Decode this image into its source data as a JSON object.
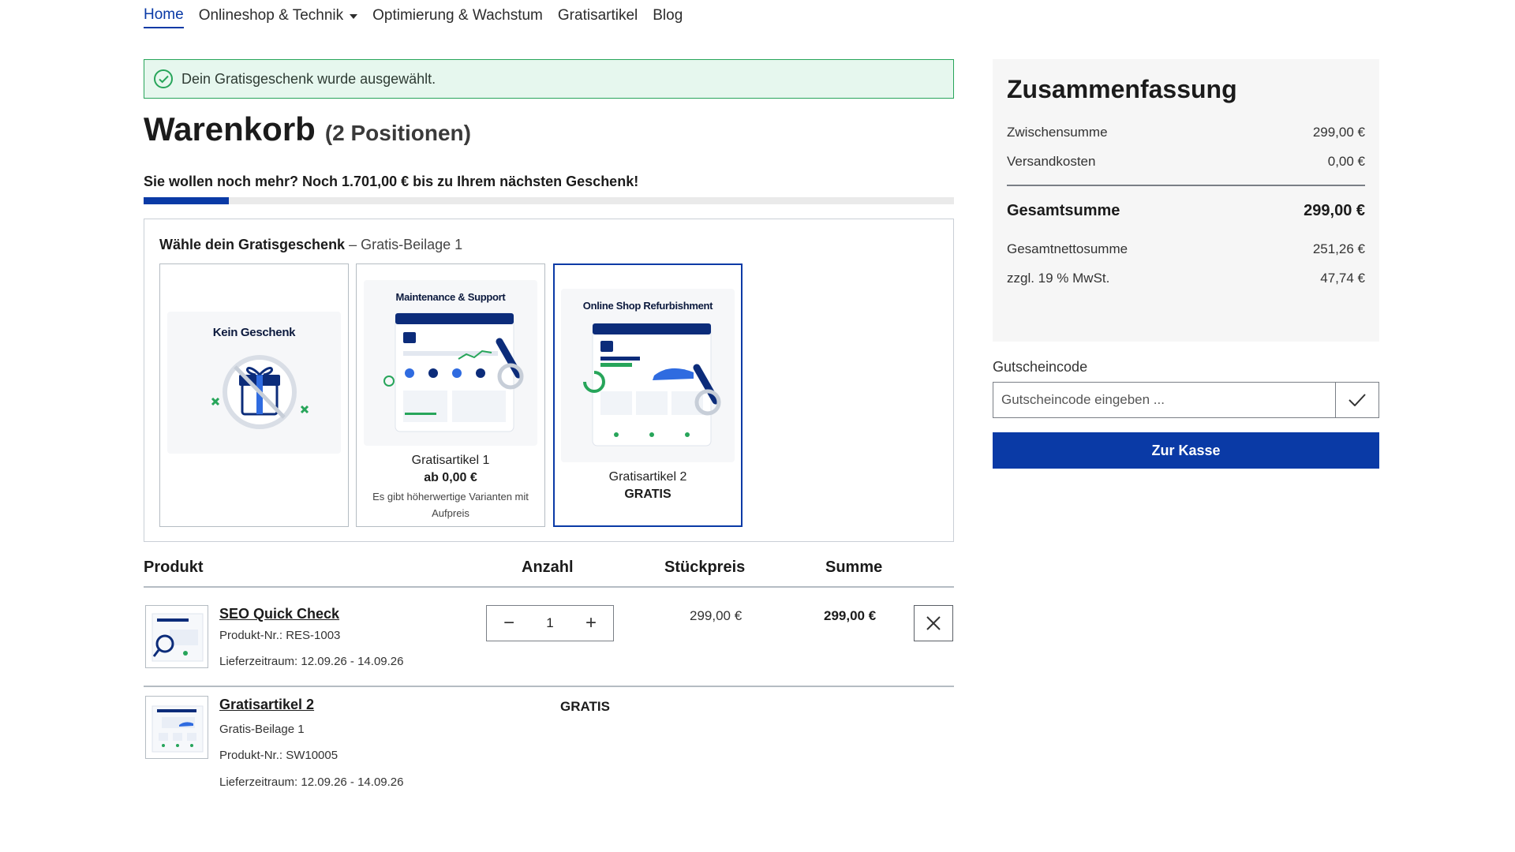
{
  "nav": {
    "items": [
      {
        "label": "Home",
        "active": true
      },
      {
        "label": "Onlineshop & Technik",
        "dropdown": true
      },
      {
        "label": "Optimierung & Wachstum"
      },
      {
        "label": "Gratisartikel"
      },
      {
        "label": "Blog"
      }
    ]
  },
  "alert": {
    "text": "Dein Gratisgeschenk wurde ausgewählt.",
    "icon": "check-circle-icon",
    "color": "#27a55a"
  },
  "cart": {
    "title": "Warenkorb",
    "count_label": "(2 Positionen)",
    "promo_text": "Sie wollen noch mehr? Noch 1.701,00 € bis zu Ihrem nächsten Geschenk!",
    "progress_fraction": 0.105
  },
  "gift": {
    "title_bold": "Wähle dein Gratisgeschenk",
    "title_rest": "– Gratis-Beilage 1",
    "cards": [
      {
        "image_title": "Kein Geschenk",
        "name": "",
        "price": "",
        "note": ""
      },
      {
        "image_title": "Maintenance & Support",
        "name": "Gratisartikel 1",
        "price": "ab 0,00 €",
        "note": "Es gibt höherwertige Varianten mit Aufpreis"
      },
      {
        "image_title": "Online Shop Refurbishment",
        "name": "Gratisartikel 2",
        "price": "GRATIS",
        "note": "",
        "selected": true
      }
    ]
  },
  "table": {
    "headers": {
      "product": "Produkt",
      "quantity": "Anzahl",
      "unit_price": "Stückpreis",
      "sum": "Summe"
    },
    "rows": [
      {
        "name": "SEO Quick Check",
        "meta": [
          "Produkt-Nr.: RES-1003",
          "Lieferzeitraum: 12.09.26 - 14.09.26"
        ],
        "quantity": "1",
        "unit_price": "299,00 €",
        "sum": "299,00 €"
      },
      {
        "name": "Gratisartikel 2",
        "meta": [
          "Gratis-Beilage 1",
          "Produkt-Nr.: SW10005",
          "Lieferzeitraum: 12.09.26 - 14.09.26"
        ],
        "price_label": "GRATIS"
      }
    ]
  },
  "summary": {
    "title": "Zusammenfassung",
    "subtotal_label": "Zwischensumme",
    "subtotal": "299,00 €",
    "shipping_label": "Versandkosten",
    "shipping": "0,00 €",
    "total_label": "Gesamtsumme",
    "total": "299,00 €",
    "net_label": "Gesamtnettosumme",
    "net": "251,26 €",
    "vat_label": "zzgl. 19 % MwSt.",
    "vat": "47,74 €"
  },
  "coupon": {
    "label": "Gutscheincode",
    "placeholder": "Gutscheincode eingeben ..."
  },
  "checkout": {
    "label": "Zur Kasse"
  },
  "colors": {
    "brand": "#0a3aa6",
    "success": "#27a55a",
    "success_bg": "#e6f7ee"
  }
}
